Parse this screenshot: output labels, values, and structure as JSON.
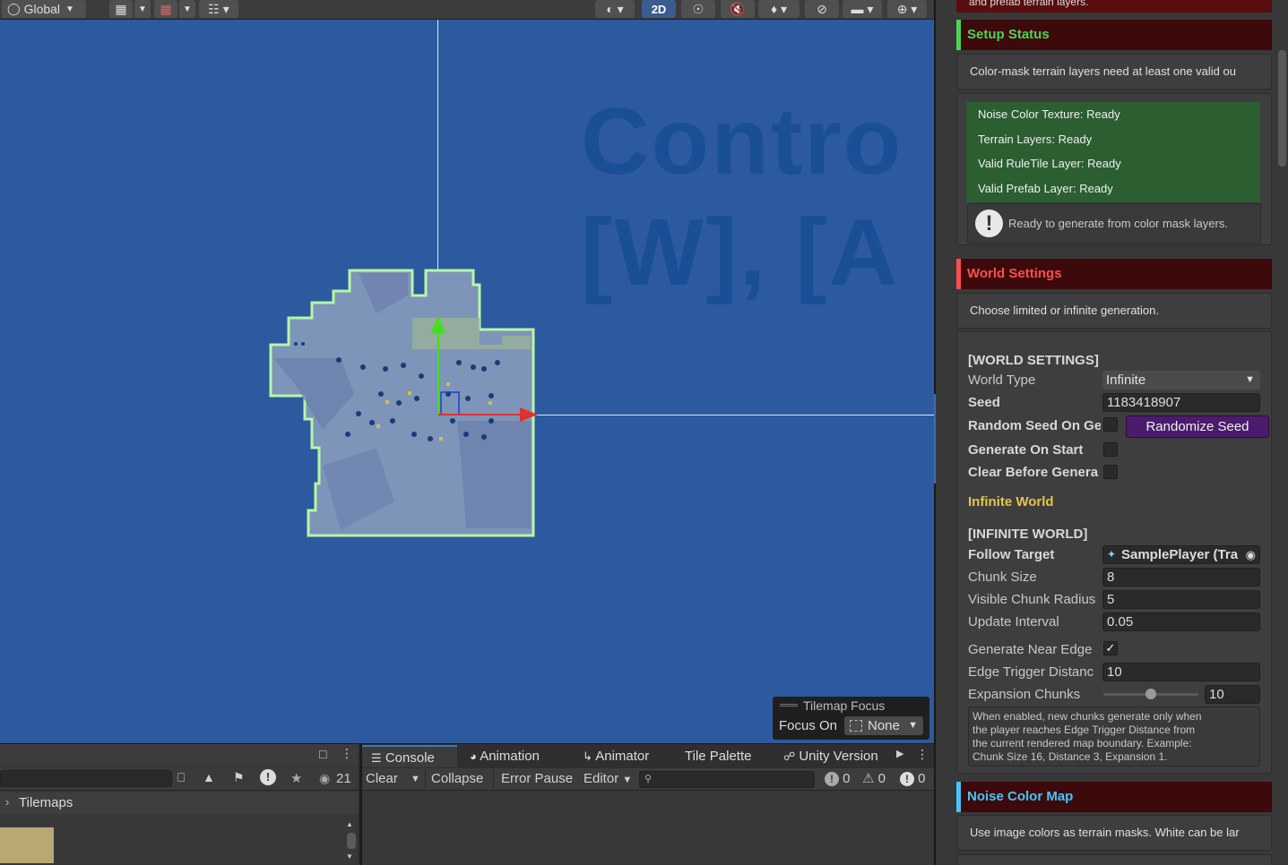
{
  "scene": {
    "toolbar": {
      "global_label": "Global",
      "mode_2d": "2D"
    },
    "overlay_line1": "Contro",
    "overlay_line2": "[W], [A",
    "tilemap_focus": {
      "title": "Tilemap Focus",
      "focus_label": "Focus On",
      "focus_value": "None"
    }
  },
  "inspector": {
    "top_text": "and prefab terrain layers.",
    "setup_status": {
      "header": "Setup Status",
      "header_color": "#4fd25a",
      "help": "Color-mask terrain layers need at least one valid ou",
      "items": [
        "Noise Color Texture: Ready",
        "Terrain Layers: Ready",
        "Valid RuleTile Layer: Ready",
        "Valid Prefab Layer: Ready"
      ],
      "ready_message": "Ready to generate from color mask layers."
    },
    "world_settings": {
      "header": "World Settings",
      "header_color": "#ff4e4e",
      "help": "Choose limited or infinite generation.",
      "section_label": "[WORLD SETTINGS]",
      "world_type_label": "World Type",
      "world_type_value": "Infinite",
      "seed_label": "Seed",
      "seed_value": "1183418907",
      "random_seed_label": "Random Seed On Ge",
      "randomize_button": "Randomize Seed",
      "generate_on_start_label": "Generate On Start",
      "clear_before_label": "Clear Before Genera",
      "infinite_world_title": "Infinite World",
      "infinite_section_label": "[INFINITE WORLD]",
      "follow_target_label": "Follow Target",
      "follow_target_value": "SamplePlayer (Tra",
      "chunk_size_label": "Chunk Size",
      "chunk_size_value": "8",
      "visible_radius_label": "Visible Chunk Radius",
      "visible_radius_value": "5",
      "update_interval_label": "Update Interval",
      "update_interval_value": "0.05",
      "generate_near_edge_label": "Generate Near Edge",
      "edge_trigger_label": "Edge Trigger Distanc",
      "edge_trigger_value": "10",
      "expansion_label": "Expansion Chunks",
      "expansion_value": "10",
      "expansion_fraction": 0.5,
      "note_lines": [
        "When enabled, new chunks generate only when",
        "the player reaches Edge Trigger Distance from",
        "the current rendered map boundary. Example:",
        "Chunk Size 16, Distance 3, Expansion 1."
      ]
    },
    "noise_color_map": {
      "header": "Noise Color Map",
      "header_color": "#45c5ff",
      "help": "Use image colors as terrain masks. White can be lar"
    }
  },
  "hierarchy": {
    "count": "21",
    "item": "Tilemaps"
  },
  "console": {
    "tabs": [
      "Console",
      "Animation",
      "Animator",
      "Tile Palette",
      "Unity Version"
    ],
    "clear": "Clear",
    "collapse": "Collapse",
    "error_pause": "Error Pause",
    "editor": "Editor",
    "info_count": "0",
    "warn_count": "0",
    "error_count": "0"
  }
}
